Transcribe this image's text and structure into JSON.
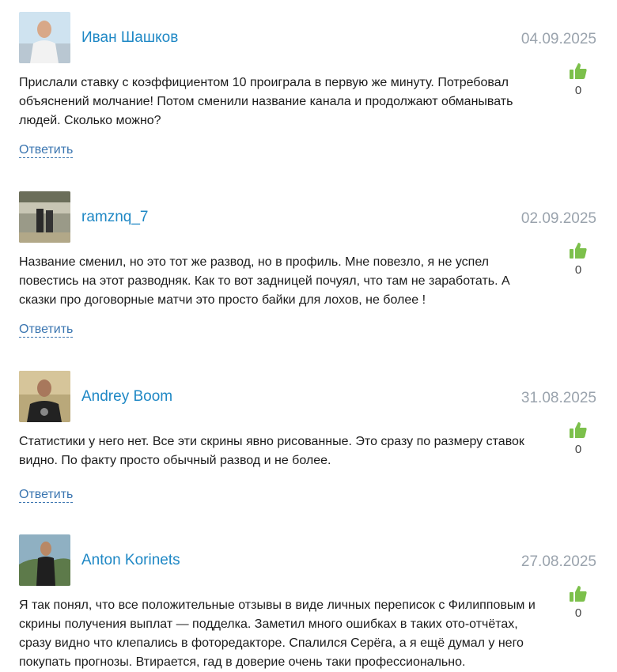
{
  "comments": [
    {
      "author": "Иван Шашков",
      "date": "04.09.2025",
      "text": "Прислали ставку с коэффициентом 10 проиграла в первую же минуту. Потребовал объяснений молчание! Потом сменили название канала и продолжают обманывать людей. Сколько можно?",
      "likes": "0",
      "reply_label": "Ответить"
    },
    {
      "author": "ramznq_7",
      "date": "02.09.2025",
      "text": "Название сменил, но это тот же развод, но в профиль. Мне повезло, я не успел повестись на этот разводняк. Как то вот задницей почуял, что там не заработать. А сказки про договорные матчи это просто байки для лохов, не более !",
      "likes": "0",
      "reply_label": "Ответить"
    },
    {
      "author": "Andrey Boom",
      "date": "31.08.2025",
      "text": "Статистики у него нет. Все эти скрины явно рисованные. Это сразу по размеру ставок видно. По факту просто обычный развод и не более.",
      "likes": "0",
      "reply_label": "Ответить"
    },
    {
      "author": "Anton Korinets",
      "date": "27.08.2025",
      "text": "Я так понял, что все положительные отзывы в виде личных переписок с Филипповым и скрины получения выплат — подделка. Заметил много ошибках в таких ото-отчётах, сразу видно что клепались в фоторедакторе. Спалился Серёга, а я ещё думал у него покупать прогнозы. Втирается, гад в доверие очень таки профессионально.",
      "likes": "0",
      "reply_label": ""
    }
  ],
  "icons": {
    "like": "thumbs-up-icon"
  },
  "colors": {
    "author_link": "#1f88c5",
    "date": "#9aa3ad",
    "like_icon": "#7cc04b",
    "reply_link": "#3a75b0"
  }
}
